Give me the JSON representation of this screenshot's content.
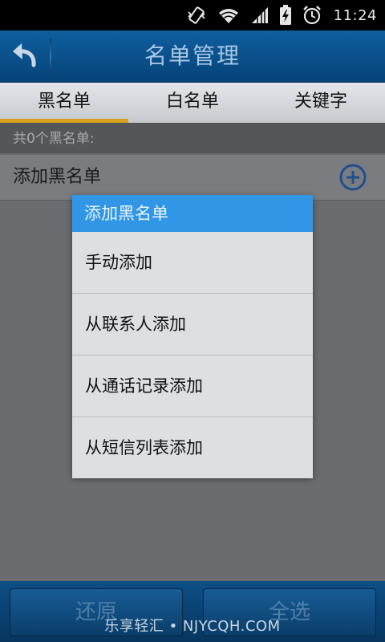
{
  "status_bar": {
    "time": "11:24",
    "icons": [
      "vibrate-icon",
      "wifi-icon",
      "signal-icon",
      "battery-charging-icon",
      "alarm-icon"
    ]
  },
  "header": {
    "title": "名单管理",
    "back_icon": "back-arrow-icon"
  },
  "tabs": [
    {
      "label": "黑名单",
      "selected": true
    },
    {
      "label": "白名单",
      "selected": false
    },
    {
      "label": "关键字",
      "selected": false
    }
  ],
  "content": {
    "count_text": "共0个黑名单:",
    "add_row_label": "添加黑名单",
    "add_icon": "plus-circle-icon"
  },
  "dialog": {
    "title": "添加黑名单",
    "items": [
      "手动添加",
      "从联系人添加",
      "从通话记录添加",
      "从短信列表添加"
    ]
  },
  "bottom_bar": {
    "restore_label": "还原",
    "select_all_label": "全选"
  },
  "watermark": "乐享轻汇 • NJYCQH.COM",
  "colors": {
    "title_bar": "#0a4f8a",
    "tab_indicator": "#d9a21e",
    "dialog_header": "#3196e6",
    "overlay_bg": "#6a6c70"
  }
}
